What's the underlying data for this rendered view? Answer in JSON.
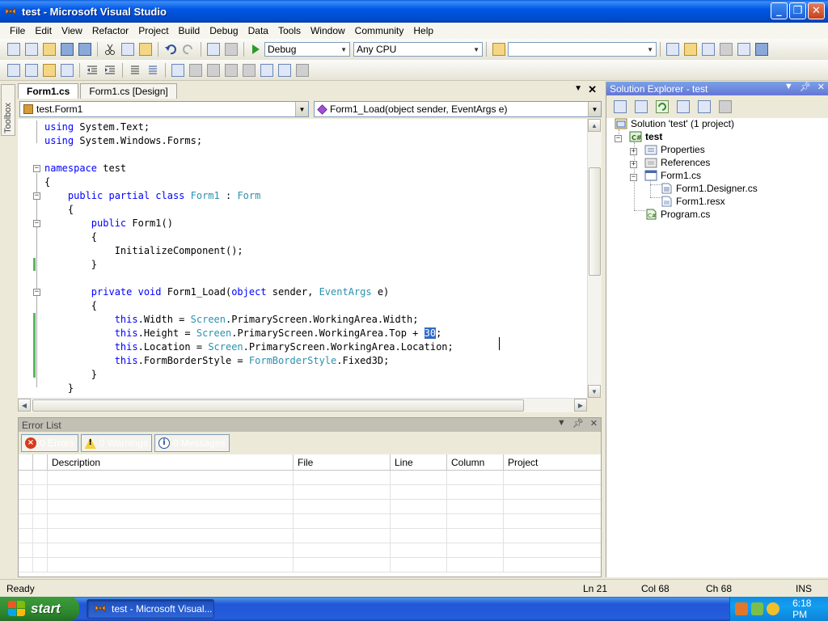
{
  "window": {
    "title": "test - Microsoft Visual Studio",
    "min": "_",
    "max": "❐",
    "close": "✕"
  },
  "menu": [
    "File",
    "Edit",
    "View",
    "Refactor",
    "Project",
    "Build",
    "Debug",
    "Data",
    "Tools",
    "Window",
    "Community",
    "Help"
  ],
  "toolbar": {
    "configuration": "Debug",
    "platform": "Any CPU",
    "find_value": ""
  },
  "toolbox": {
    "label": "Toolbox"
  },
  "document_tabs": [
    {
      "label": "Form1.cs",
      "active": true
    },
    {
      "label": "Form1.cs [Design]",
      "active": false
    }
  ],
  "nav": {
    "class_combo": "test.Form1",
    "member_combo": "Form1_Load(object sender, EventArgs e)"
  },
  "code": {
    "lines": [
      [
        {
          "t": "using ",
          "c": "kw"
        },
        {
          "t": "System.Text;"
        }
      ],
      [
        {
          "t": "using ",
          "c": "kw"
        },
        {
          "t": "System.Windows.Forms;"
        }
      ],
      [],
      [
        {
          "t": "namespace ",
          "c": "kw"
        },
        {
          "t": "test"
        }
      ],
      [
        {
          "t": "{"
        }
      ],
      [
        {
          "t": "    "
        },
        {
          "t": "public partial class ",
          "c": "kw"
        },
        {
          "t": "Form1",
          "c": "ty"
        },
        {
          "t": " : "
        },
        {
          "t": "Form",
          "c": "ty"
        }
      ],
      [
        {
          "t": "    {"
        }
      ],
      [
        {
          "t": "        "
        },
        {
          "t": "public ",
          "c": "kw"
        },
        {
          "t": "Form1()"
        }
      ],
      [
        {
          "t": "        {"
        }
      ],
      [
        {
          "t": "            InitializeComponent();"
        }
      ],
      [
        {
          "t": "        }"
        }
      ],
      [],
      [
        {
          "t": "        "
        },
        {
          "t": "private void ",
          "c": "kw"
        },
        {
          "t": "Form1_Load("
        },
        {
          "t": "object ",
          "c": "kw"
        },
        {
          "t": "sender, "
        },
        {
          "t": "EventArgs",
          "c": "ty"
        },
        {
          "t": " e)"
        }
      ],
      [
        {
          "t": "        {"
        }
      ],
      [
        {
          "t": "            "
        },
        {
          "t": "this",
          "c": "kw"
        },
        {
          "t": ".Width = "
        },
        {
          "t": "Screen",
          "c": "ty"
        },
        {
          "t": ".PrimaryScreen.WorkingArea.Width;"
        }
      ],
      [
        {
          "t": "            "
        },
        {
          "t": "this",
          "c": "kw"
        },
        {
          "t": ".Height = "
        },
        {
          "t": "Screen",
          "c": "ty"
        },
        {
          "t": ".PrimaryScreen.WorkingArea.Top + "
        },
        {
          "t": "30",
          "c": "sel"
        },
        {
          "t": ";"
        }
      ],
      [
        {
          "t": "            "
        },
        {
          "t": "this",
          "c": "kw"
        },
        {
          "t": ".Location = "
        },
        {
          "t": "Screen",
          "c": "ty"
        },
        {
          "t": ".PrimaryScreen.WorkingArea.Location;"
        }
      ],
      [
        {
          "t": "            "
        },
        {
          "t": "this",
          "c": "kw"
        },
        {
          "t": ".FormBorderStyle = "
        },
        {
          "t": "FormBorderStyle",
          "c": "ty"
        },
        {
          "t": ".Fixed3D;"
        }
      ],
      [
        {
          "t": "        }"
        }
      ],
      [
        {
          "t": "    }"
        }
      ]
    ]
  },
  "error_list": {
    "title": "Error List",
    "filters": {
      "errors": "0 Errors",
      "warnings": "0 Warnings",
      "messages": "0 Messages"
    },
    "columns": [
      "",
      "",
      "Description",
      "File",
      "Line",
      "Column",
      "Project"
    ]
  },
  "solution_explorer": {
    "title": "Solution Explorer - test",
    "items": {
      "solution": "Solution 'test' (1 project)",
      "project": "test",
      "properties": "Properties",
      "references": "References",
      "form1": "Form1.cs",
      "form1_designer": "Form1.Designer.cs",
      "form1_resx": "Form1.resx",
      "program": "Program.cs"
    }
  },
  "status": {
    "text": "Ready",
    "line": "Ln 21",
    "col": "Col 68",
    "ch": "Ch 68",
    "mode": "INS"
  },
  "taskbar": {
    "start": "start",
    "task": "test - Microsoft Visual...",
    "clock": "6:18 PM"
  }
}
